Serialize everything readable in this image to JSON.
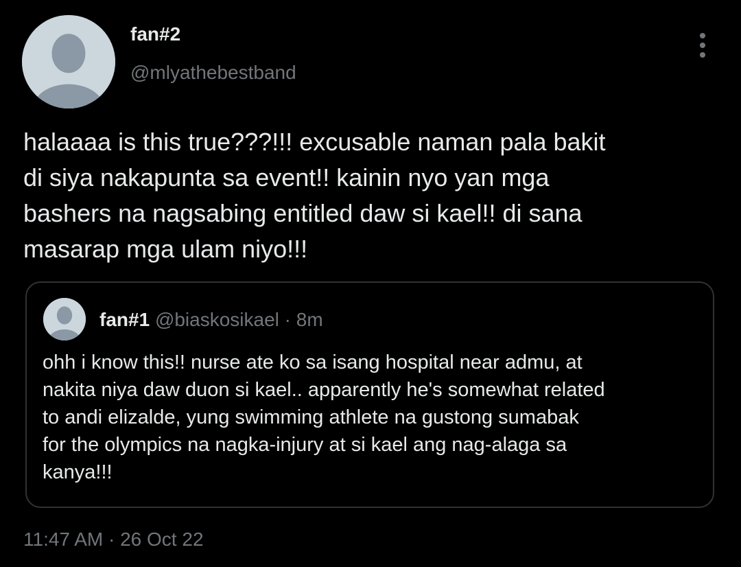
{
  "tweet": {
    "author": {
      "display_name": "fan#2",
      "handle": "@mlyathebestband",
      "avatar_icon": "default-profile-icon"
    },
    "more_icon": "more-options-icon",
    "text": "halaaaa is this true???!!! excusable naman pala bakit\ndi siya nakapunta sa event!! kainin nyo yan mga\nbashers na nagsabing entitled daw si kael!! di sana\nmasarap mga ulam niyo!!!",
    "quoted_tweet": {
      "author": {
        "display_name": "fan#1",
        "handle": "@biaskosikael",
        "avatar_icon": "default-profile-icon"
      },
      "separator": "·",
      "time": "8m",
      "text": "ohh i know this!! nurse ate ko sa isang hospital near admu, at\nnakita niya daw duon si kael.. apparently he's somewhat related\nto andi elizalde, yung swimming athlete na gustong sumabak\nfor the olympics na nagka-injury at si kael ang nag-alaga sa\nkanya!!!"
    },
    "timestamp": "11:47 AM · 26 Oct 22"
  },
  "colors": {
    "background": "#000000",
    "primary_text": "#e7e9ea",
    "secondary_text": "#71767b",
    "border": "#2f3336",
    "avatar_bg": "#ccd6dd",
    "avatar_fg": "#8b98a5"
  }
}
